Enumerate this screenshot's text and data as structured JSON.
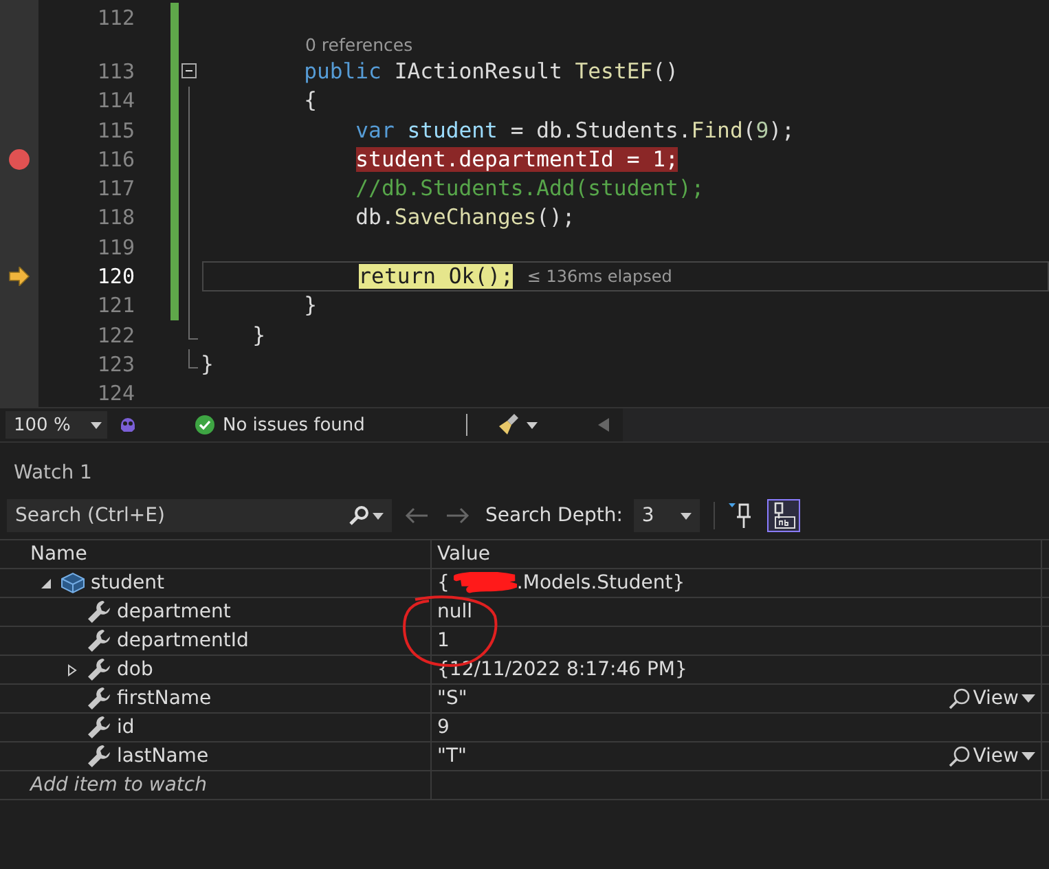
{
  "editor": {
    "lines": [
      {
        "number": "112",
        "changed": true
      },
      {
        "number": "113",
        "changed": true,
        "codelens": "0 references",
        "collapsible": true,
        "tokens": [
          {
            "text": "        public",
            "kind": "keyword"
          },
          {
            "text": " IActionResult ",
            "kind": "plain"
          },
          {
            "text": "TestEF",
            "kind": "method"
          },
          {
            "text": "()",
            "kind": "plain"
          }
        ]
      },
      {
        "number": "114",
        "changed": true,
        "in_fold": true,
        "tokens": [
          {
            "text": "        {",
            "kind": "plain"
          }
        ]
      },
      {
        "number": "115",
        "changed": true,
        "in_fold": true,
        "tokens": [
          {
            "text": "            var",
            "kind": "keyword"
          },
          {
            "text": " student",
            "kind": "variable"
          },
          {
            "text": " = db.Students.",
            "kind": "plain"
          },
          {
            "text": "Find",
            "kind": "method"
          },
          {
            "text": "(",
            "kind": "plain"
          },
          {
            "text": "9",
            "kind": "number"
          },
          {
            "text": ");",
            "kind": "plain"
          }
        ]
      },
      {
        "number": "116",
        "changed": true,
        "in_fold": true,
        "breakpoint": true,
        "tokens": [
          {
            "text": "            student",
            "kind": "variable"
          },
          {
            "text": ".departmentId = ",
            "kind": "plain"
          },
          {
            "text": "1",
            "kind": "number"
          },
          {
            "text": ";",
            "kind": "plain"
          }
        ]
      },
      {
        "number": "117",
        "changed": true,
        "in_fold": true,
        "tokens": [
          {
            "text": "            //db.Students.Add(student);",
            "kind": "comment"
          }
        ]
      },
      {
        "number": "118",
        "changed": true,
        "in_fold": true,
        "tokens": [
          {
            "text": "            db.",
            "kind": "plain"
          },
          {
            "text": "SaveChanges",
            "kind": "method"
          },
          {
            "text": "();",
            "kind": "plain"
          }
        ]
      },
      {
        "number": "119",
        "changed": true,
        "in_fold": true
      },
      {
        "number": "120",
        "changed": true,
        "in_fold": true,
        "current": true,
        "hint": "≤ 136ms elapsed",
        "tokens": [
          {
            "text": "            return",
            "kind": "control"
          },
          {
            "text": " Ok",
            "kind": "method"
          },
          {
            "text": "();",
            "kind": "plain"
          }
        ]
      },
      {
        "number": "121",
        "changed": true,
        "in_fold": true,
        "tokens": [
          {
            "text": "        }",
            "kind": "plain"
          }
        ]
      },
      {
        "number": "122",
        "fold_end": true,
        "tokens": [
          {
            "text": "    }",
            "kind": "plain"
          }
        ]
      },
      {
        "number": "123",
        "fold_end": true,
        "tokens": [
          {
            "text": "}",
            "kind": "plain"
          }
        ]
      },
      {
        "number": "124"
      }
    ]
  },
  "status_bar": {
    "zoom": "100 %",
    "issues": "No issues found"
  },
  "watch": {
    "title": "Watch 1",
    "search": {
      "placeholder": "Search (Ctrl+E)"
    },
    "depth_label": "Search Depth:",
    "depth": "3",
    "columns": [
      "Name",
      "Value"
    ],
    "rows": [
      {
        "name": "student",
        "kind": "object",
        "expanded": true,
        "value": "{",
        "redacted": true,
        "value_tail": ".Models.Student}",
        "children": [
          {
            "name": "department",
            "kind": "property",
            "value": "null"
          },
          {
            "name": "departmentId",
            "kind": "property",
            "value": "1"
          },
          {
            "name": "dob",
            "kind": "property",
            "expanded": false,
            "value": "{12/11/2022 8:17:46 PM}"
          },
          {
            "name": "firstName",
            "kind": "property",
            "value": "\"S\"",
            "visualizer": "View"
          },
          {
            "name": "id",
            "kind": "property",
            "value": "9"
          },
          {
            "name": "lastName",
            "kind": "property",
            "value": "\"T\"",
            "visualizer": "View"
          }
        ]
      }
    ],
    "add_placeholder": "Add item to watch"
  }
}
